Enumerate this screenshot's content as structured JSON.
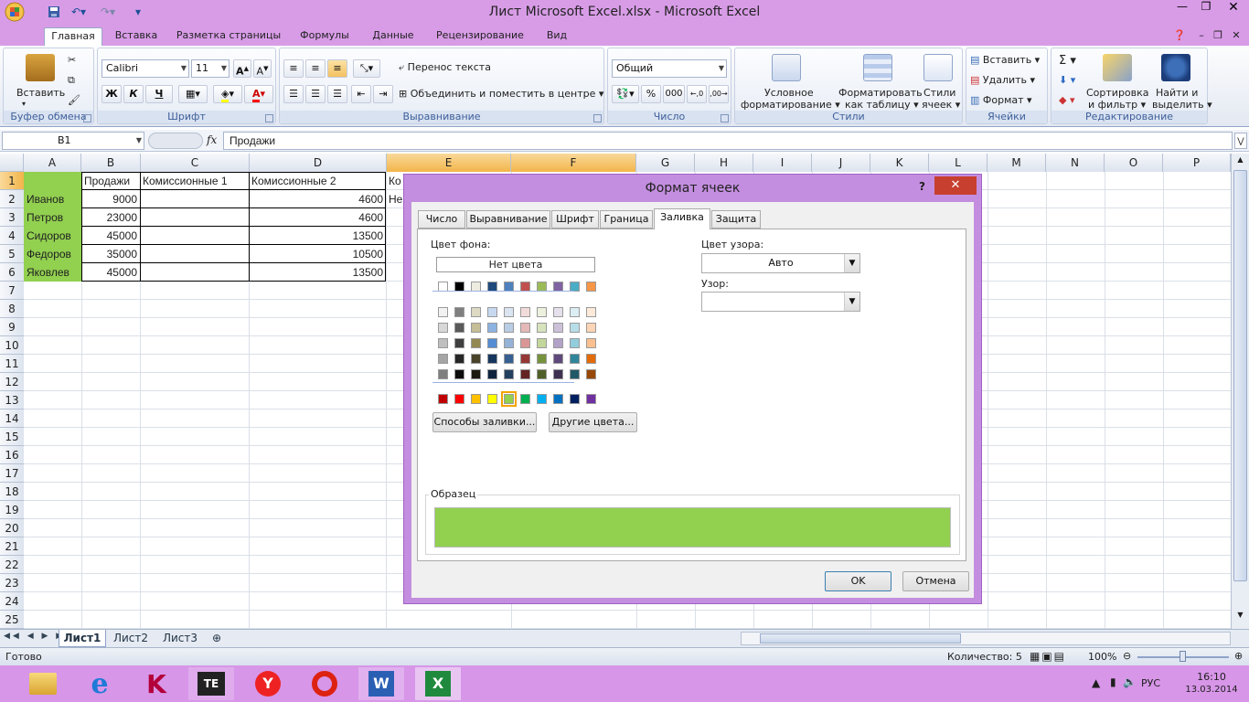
{
  "window": {
    "title": "Лист Microsoft Excel.xlsx - Microsoft Excel"
  },
  "ribbon_tabs": [
    "Главная",
    "Вставка",
    "Разметка страницы",
    "Формулы",
    "Данные",
    "Рецензирование",
    "Вид"
  ],
  "ribbon": {
    "paste_label": "Вставить",
    "clipboard_group": "Буфер обмена",
    "font_name": "Calibri",
    "font_size": "11",
    "font_group": "Шрифт",
    "bold": "Ж",
    "italic": "К",
    "underline": "Ч",
    "wrap_text": "Перенос текста",
    "merge_center": "Объединить и поместить в центре",
    "alignment_group": "Выравнивание",
    "number_format": "Общий",
    "number_group": "Число",
    "percent": "%",
    "thousands": "000",
    "cond_format_1": "Условное",
    "cond_format_2": "форматирование",
    "format_table_1": "Форматировать",
    "format_table_2": "как таблицу",
    "cell_styles_1": "Стили",
    "cell_styles_2": "ячеек",
    "styles_group": "Стили",
    "insert_cells": "Вставить",
    "delete_cells": "Удалить",
    "format_cells": "Формат",
    "cells_group": "Ячейки",
    "sort_filter_1": "Сортировка",
    "sort_filter_2": "и фильтр",
    "find_select_1": "Найти и",
    "find_select_2": "выделить",
    "editing_group": "Редактирование"
  },
  "formula_bar": {
    "name_box": "B1",
    "fx": "fx",
    "value": "Продажи"
  },
  "columns": [
    "A",
    "B",
    "C",
    "D",
    "E",
    "F",
    "G",
    "H",
    "I",
    "J",
    "K",
    "L",
    "M",
    "N",
    "O",
    "P"
  ],
  "rows": [
    "1",
    "2",
    "3",
    "4",
    "5",
    "6",
    "7",
    "8",
    "9",
    "10",
    "11",
    "12",
    "13",
    "14",
    "15",
    "16",
    "17",
    "18",
    "19",
    "20",
    "21",
    "22",
    "23",
    "24",
    "25"
  ],
  "table": {
    "headers": {
      "b": "Продажи",
      "c": "Комиссионные 1",
      "d": "Комиссионные 2",
      "e": "Ко"
    },
    "rows": [
      {
        "name": "Иванов",
        "sales": "9000",
        "comm2": "4600",
        "e": "Не"
      },
      {
        "name": "Петров",
        "sales": "23000",
        "comm2": "4600",
        "e": ""
      },
      {
        "name": "Сидоров",
        "sales": "45000",
        "comm2": "13500",
        "e": ""
      },
      {
        "name": "Федоров",
        "sales": "35000",
        "comm2": "10500",
        "e": ""
      },
      {
        "name": "Яковлев",
        "sales": "45000",
        "comm2": "13500",
        "e": ""
      }
    ]
  },
  "sheets": [
    "Лист1",
    "Лист2",
    "Лист3"
  ],
  "status": {
    "ready": "Готово",
    "count": "Количество: 5",
    "zoom": "100%"
  },
  "taskbar": {
    "lang": "РУС",
    "time": "16:10",
    "date": "13.03.2014"
  },
  "dialog": {
    "title": "Формат ячеек",
    "help": "?",
    "tabs": [
      "Число",
      "Выравнивание",
      "Шрифт",
      "Граница",
      "Заливка",
      "Защита"
    ],
    "bg_color_label": "Цвет фона:",
    "no_color": "Нет цвета",
    "pattern_color_label": "Цвет узора:",
    "pattern_color_value": "Авто",
    "pattern_label": "Узор:",
    "fill_effects": "Способы заливки...",
    "more_colors": "Другие цвета...",
    "sample_label": "Образец",
    "ok": "OK",
    "cancel": "Отмена",
    "sample_color": "#92d050",
    "theme_top": [
      "#ffffff",
      "#000000",
      "#eeece1",
      "#1f497d",
      "#4f81bd",
      "#c0504d",
      "#9bbb59",
      "#8064a2",
      "#4bacc6",
      "#f79646"
    ],
    "theme_shades": [
      [
        "#f2f2f2",
        "#7f7f7f",
        "#ddd9c3",
        "#c6d9f0",
        "#dbe5f1",
        "#f2dcdb",
        "#ebf1dd",
        "#e5e0ec",
        "#dbeef3",
        "#fdeada"
      ],
      [
        "#d8d8d8",
        "#595959",
        "#c4bd97",
        "#8db3e2",
        "#b8cce4",
        "#e5b9b7",
        "#d7e3bc",
        "#ccc1d9",
        "#b7dde8",
        "#fbd5b5"
      ],
      [
        "#bfbfbf",
        "#3f3f3f",
        "#938953",
        "#548dd4",
        "#95b3d7",
        "#d99694",
        "#c3d69b",
        "#b2a2c7",
        "#92cddc",
        "#fac08f"
      ],
      [
        "#a5a5a5",
        "#262626",
        "#494429",
        "#17365d",
        "#366092",
        "#953734",
        "#76923c",
        "#5f497a",
        "#31859b",
        "#e36c09"
      ],
      [
        "#7f7f7f",
        "#0c0c0c",
        "#1d1b10",
        "#0f243e",
        "#244061",
        "#632423",
        "#4f6128",
        "#3f3151",
        "#205867",
        "#974806"
      ]
    ],
    "standard": [
      "#c00000",
      "#ff0000",
      "#ffc000",
      "#ffff00",
      "#92d050",
      "#00b050",
      "#00b0f0",
      "#0070c0",
      "#002060",
      "#7030a0"
    ]
  }
}
